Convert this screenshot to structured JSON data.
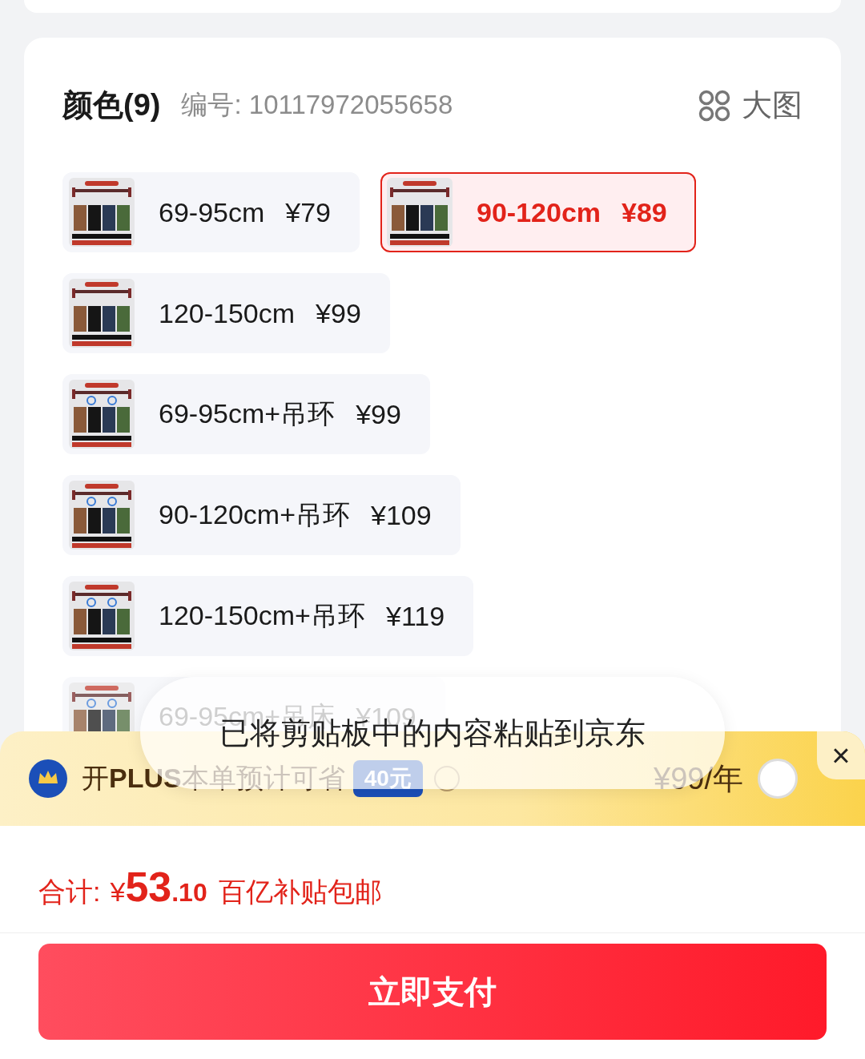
{
  "spec_header": {
    "title": "颜色(9)",
    "code": "编号: 10117972055658",
    "view_toggle": "大图"
  },
  "options": [
    {
      "label": "69-95cm",
      "price": "¥79",
      "selected": false
    },
    {
      "label": "90-120cm",
      "price": "¥89",
      "selected": true
    },
    {
      "label": "120-150cm",
      "price": "¥99",
      "selected": false
    },
    {
      "label": "69-95cm+吊环",
      "price": "¥99",
      "selected": false
    },
    {
      "label": "90-120cm+吊环",
      "price": "¥109",
      "selected": false
    },
    {
      "label": "120-150cm+吊环",
      "price": "¥119",
      "selected": false
    },
    {
      "label": "69-95cm+吊床",
      "price": "¥109",
      "selected": false
    }
  ],
  "toast": "已将剪贴板中的内容粘贴到京东",
  "plus_bar": {
    "text": "开**PLUS**本单预计可省",
    "badge": "40元",
    "price": "¥99/年",
    "selected": false,
    "close": "×"
  },
  "total": {
    "label": "合计:",
    "currency": "¥",
    "integer": "53",
    "decimal": ".10",
    "note": "百亿补贴包邮"
  },
  "pay_button": "立即支付"
}
